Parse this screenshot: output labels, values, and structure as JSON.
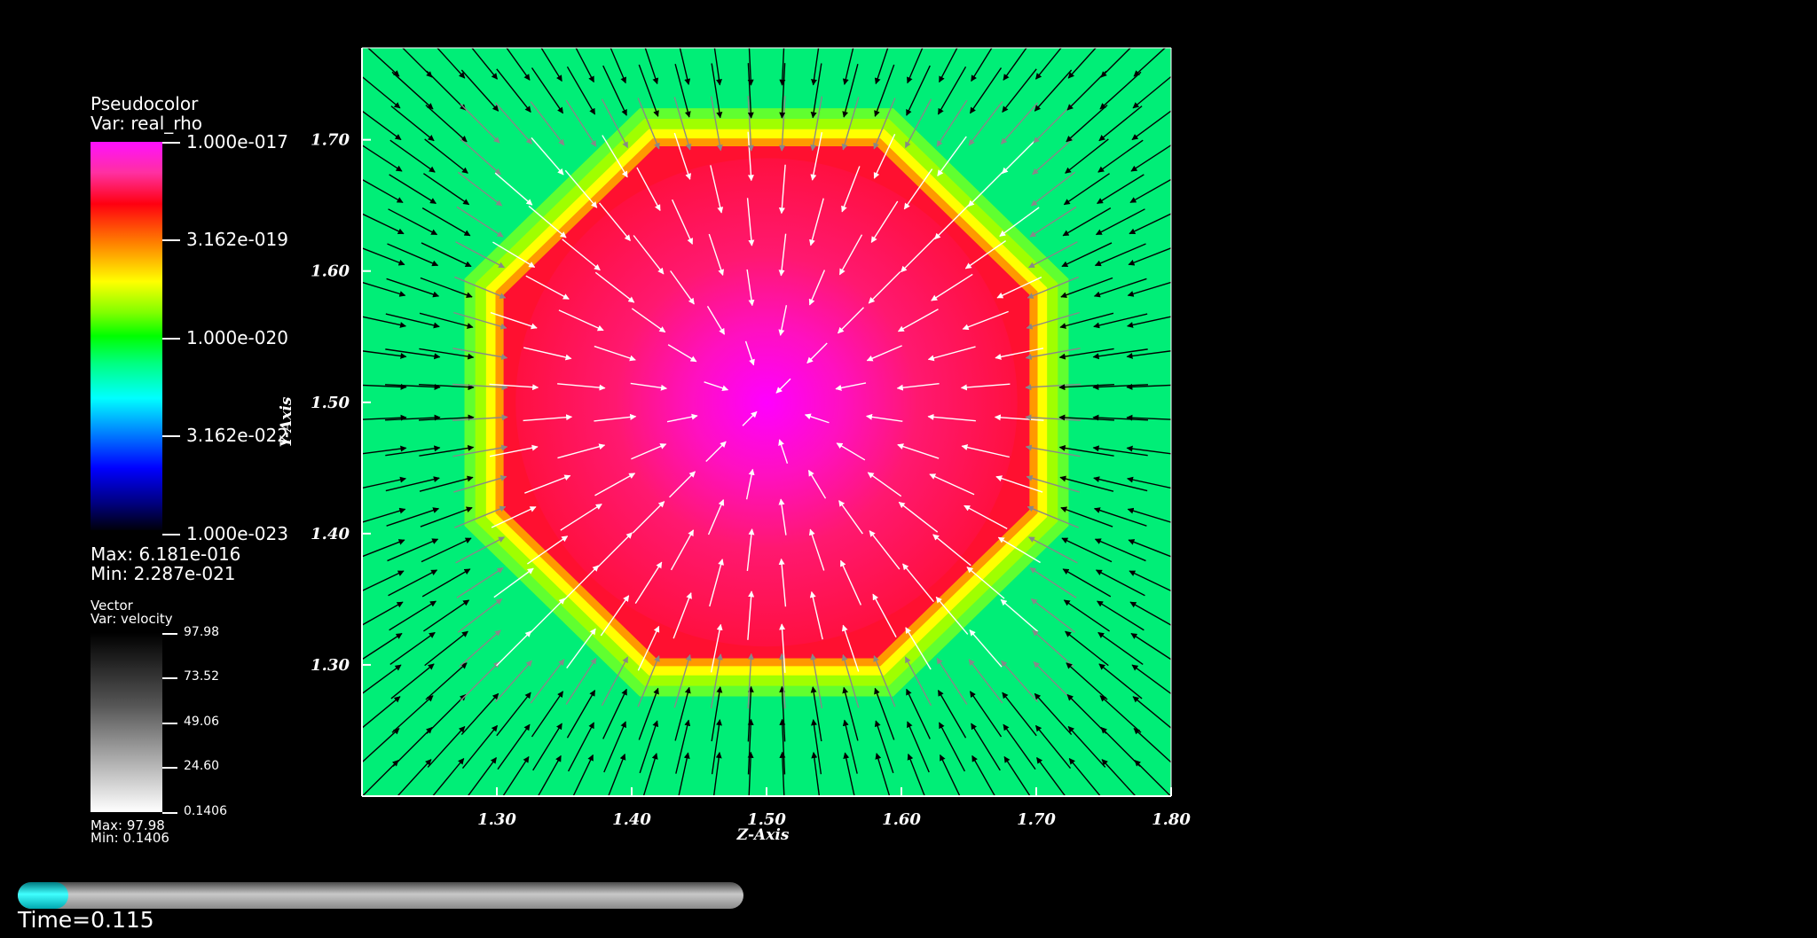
{
  "legend_pseudocolor": {
    "title": "Pseudocolor",
    "var": "Var: real_rho",
    "ticks": [
      "1.000e-017",
      "3.162e-019",
      "1.000e-020",
      "3.162e-022",
      "1.000e-023"
    ],
    "max": "Max:  6.181e-016",
    "min": "Min:  2.287e-021"
  },
  "legend_vector": {
    "title": "Vector",
    "var": "Var: velocity",
    "ticks": [
      "97.98",
      "73.52",
      "49.06",
      "24.60",
      "0.1406"
    ],
    "max": "Max: 97.98",
    "min": "Min: 0.1406"
  },
  "time": {
    "label": "Time=0.115",
    "progress": 0.07
  },
  "chart_data": {
    "type": "heatmap",
    "title": "",
    "xlabel": "Z-Axis",
    "ylabel": "Y-Axis",
    "xlim": [
      1.2,
      1.8
    ],
    "ylim": [
      1.2,
      1.77
    ],
    "xticks": [
      "1.30",
      "1.40",
      "1.50",
      "1.60",
      "1.70",
      "1.80"
    ],
    "yticks": [
      "1.30",
      "1.40",
      "1.50",
      "1.60",
      "1.70"
    ],
    "xtick_values": [
      1.3,
      1.4,
      1.5,
      1.6,
      1.7,
      1.8
    ],
    "ytick_values": [
      1.3,
      1.4,
      1.5,
      1.6,
      1.7
    ],
    "field": "real_rho",
    "field_scale": "log",
    "background_value": 1e-20,
    "blob_center": [
      1.5,
      1.5
    ],
    "blob_half_width": 0.2,
    "blob_peak_value": 1e-17,
    "colors": {
      "background": "#00ee77",
      "blob_edge": "#ff1030",
      "blob_mid": "#ff1a60",
      "blob_core": "#ff00ff",
      "ring_yellow": "#ffff00",
      "ring_orange": "#ff9900",
      "ring_lime": "#a0ff00"
    },
    "vector_field": "velocity",
    "vector_max": 97.98,
    "vector_min": 0.1406
  }
}
